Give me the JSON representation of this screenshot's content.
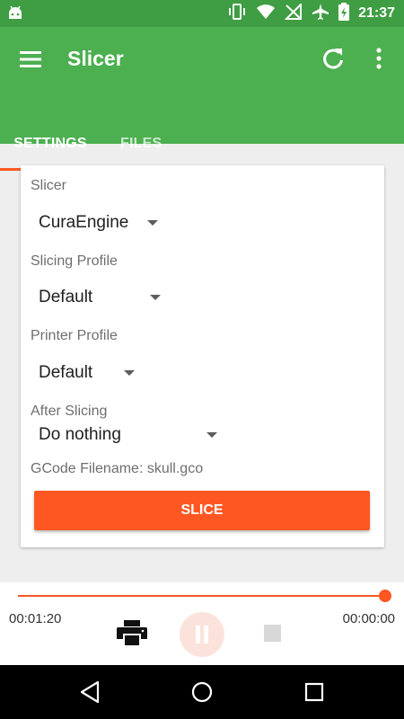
{
  "status_bar": {
    "time": "21:37",
    "icons": [
      "android-icon",
      "vibrate-icon",
      "wifi-icon",
      "no-signal-icon",
      "airplane-mode-icon",
      "battery-charging-icon"
    ]
  },
  "app_bar": {
    "title": "Slicer",
    "icons": [
      "menu-icon",
      "refresh-icon",
      "overflow-menu-icon"
    ],
    "colors": {
      "primary": "#4caf50",
      "primary_dark": "#3f9e43",
      "accent": "#ff5722"
    }
  },
  "tabs": [
    {
      "label": "SETTINGS",
      "active": true
    },
    {
      "label": "FILES",
      "active": false
    }
  ],
  "form": {
    "slicer": {
      "label": "Slicer",
      "value": "CuraEngine"
    },
    "slicing_profile": {
      "label": "Slicing Profile",
      "value": "Default"
    },
    "printer_profile": {
      "label": "Printer Profile",
      "value": "Default"
    },
    "after_slicing": {
      "label": "After Slicing",
      "value": "Do nothing"
    },
    "gcode_filename": "GCode Filename: skull.gco",
    "slice_button": "SLICE"
  },
  "player": {
    "elapsed": "00:01:20",
    "remaining": "00:00:00",
    "progress": 1.0,
    "icons": [
      "print-icon",
      "pause-icon",
      "stop-icon"
    ]
  },
  "nav_bar": {
    "icons": [
      "back-icon",
      "home-icon",
      "recents-icon"
    ]
  }
}
